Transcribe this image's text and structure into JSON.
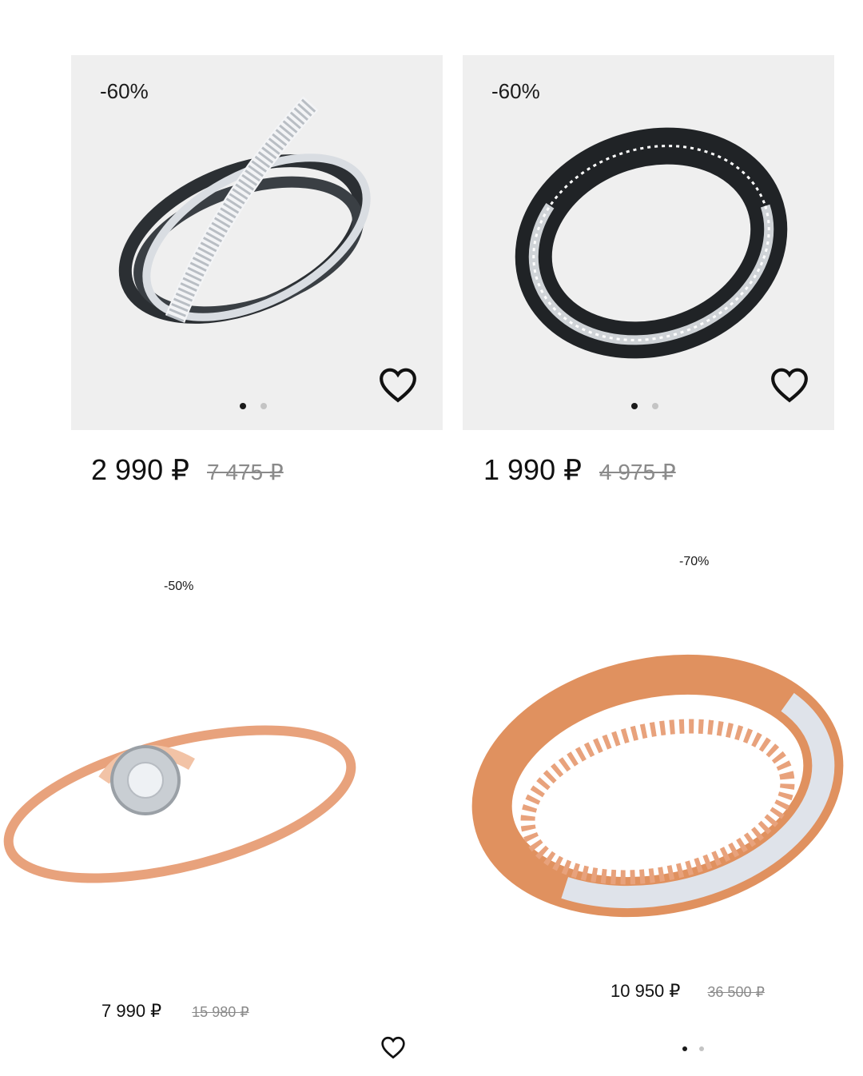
{
  "products": [
    {
      "discount": "-60%",
      "price": "2 990 ₽",
      "old_price": "7 475 ₽",
      "image_dots": 2,
      "active_dot": 0,
      "favorite_icon": "heart-outline-icon"
    },
    {
      "discount": "-60%",
      "price": "1 990 ₽",
      "old_price": "4 975 ₽",
      "image_dots": 2,
      "active_dot": 0,
      "favorite_icon": "heart-outline-icon"
    },
    {
      "discount": "-50%",
      "price": "7 990 ₽",
      "old_price": "15 980 ₽",
      "favorite_icon": "heart-outline-icon"
    },
    {
      "discount": "-70%",
      "price": "10 950 ₽",
      "old_price": "36 500 ₽",
      "image_dots": 2,
      "active_dot": 0
    }
  ],
  "colors": {
    "image_bg_gray": "#efefef",
    "text": "#1a1a1a",
    "old_price": "#8a8a8a",
    "rose_gold": "#e8a27c"
  }
}
